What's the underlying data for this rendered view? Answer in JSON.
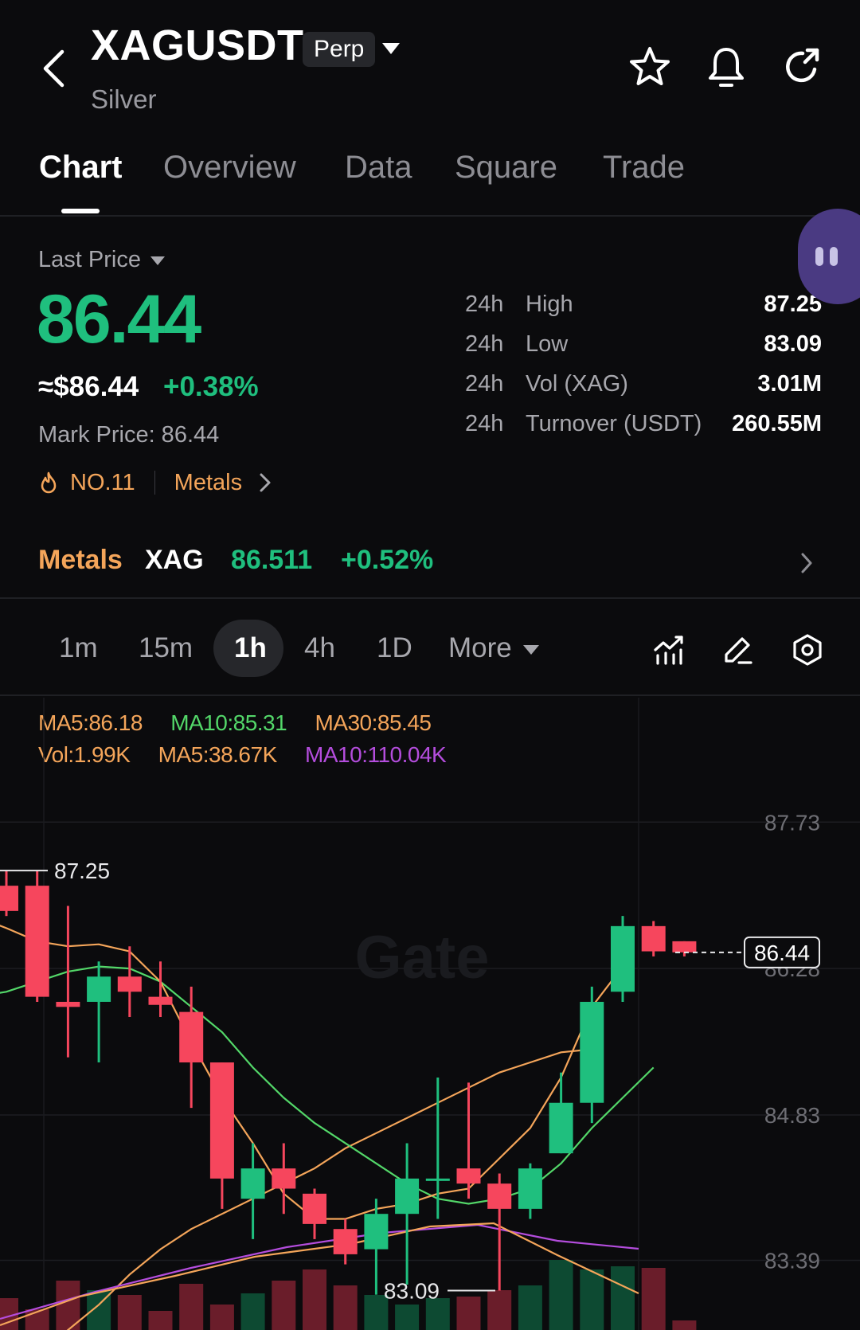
{
  "header": {
    "symbol": "XAGUSDT",
    "badge": "Perp",
    "subtitle": "Silver",
    "icons": [
      "back-icon",
      "star-icon",
      "bell-icon",
      "share-icon"
    ]
  },
  "tabs": [
    {
      "label": "Chart",
      "active": true
    },
    {
      "label": "Overview",
      "active": false
    },
    {
      "label": "Data",
      "active": false
    },
    {
      "label": "Square",
      "active": false
    },
    {
      "label": "Trade",
      "active": false
    }
  ],
  "price": {
    "label": "Last Price",
    "last": "86.44",
    "usd": "≈$86.44",
    "change": "+0.38%",
    "mark": "Mark Price: 86.44",
    "rank": "NO.11",
    "category": "Metals"
  },
  "stats": [
    {
      "period": "24h",
      "label": "High",
      "value": "87.25"
    },
    {
      "period": "24h",
      "label": "Low",
      "value": "83.09"
    },
    {
      "period": "24h",
      "label": "Vol (XAG)",
      "value": "3.01M"
    },
    {
      "period": "24h",
      "label": "Turnover (USDT)",
      "value": "260.55M"
    }
  ],
  "index": {
    "category": "Metals",
    "symbol": "XAG",
    "price": "86.511",
    "change": "+0.52%"
  },
  "intervals": [
    {
      "label": "1m",
      "active": false
    },
    {
      "label": "15m",
      "active": false
    },
    {
      "label": "1h",
      "active": true
    },
    {
      "label": "4h",
      "active": false
    },
    {
      "label": "1D",
      "active": false
    },
    {
      "label": "More",
      "active": false
    }
  ],
  "tools": [
    "indicator-icon",
    "draw-icon",
    "settings-icon"
  ],
  "legend": {
    "ma5": "MA5:86.18",
    "ma10": "MA10:85.31",
    "ma30": "MA30:85.45",
    "vol": "Vol:1.99K",
    "vol_ma5": "MA5:38.67K",
    "vol_ma10": "MA10:110.04K"
  },
  "colors": {
    "up": "#1fbf7e",
    "down": "#f6465d",
    "ma5": "#f4a55a",
    "ma10": "#53d769",
    "ma30": "#f4a55a",
    "vol_ma10": "#b44ddd",
    "accent": "#f4a55a"
  },
  "watermark": "Gate",
  "chart_data": {
    "type": "candlestick",
    "interval": "1h",
    "y_axis_labels": [
      "87.73",
      "86.28",
      "84.83",
      "83.39"
    ],
    "ylim": [
      82.7,
      88.3
    ],
    "current_price_label": "86.44",
    "high_marker": "87.25",
    "low_marker": "83.09",
    "candles": [
      {
        "o": 87.1,
        "c": 86.85,
        "h": 87.25,
        "l": 86.8
      },
      {
        "o": 87.1,
        "c": 86.0,
        "h": 87.25,
        "l": 85.95
      },
      {
        "o": 85.95,
        "c": 85.9,
        "h": 86.9,
        "l": 85.4
      },
      {
        "o": 85.95,
        "c": 86.2,
        "h": 86.35,
        "l": 85.35
      },
      {
        "o": 86.2,
        "c": 86.05,
        "h": 86.5,
        "l": 85.8
      },
      {
        "o": 86.0,
        "c": 85.92,
        "h": 86.35,
        "l": 85.8
      },
      {
        "o": 85.85,
        "c": 85.35,
        "h": 86.1,
        "l": 84.9
      },
      {
        "o": 85.35,
        "c": 84.2,
        "h": 85.35,
        "l": 83.9
      },
      {
        "o": 84.0,
        "c": 84.3,
        "h": 84.55,
        "l": 83.6
      },
      {
        "o": 84.3,
        "c": 84.1,
        "h": 84.55,
        "l": 83.85
      },
      {
        "o": 84.05,
        "c": 83.75,
        "h": 84.1,
        "l": 83.6
      },
      {
        "o": 83.7,
        "c": 83.45,
        "h": 83.8,
        "l": 83.35
      },
      {
        "o": 83.5,
        "c": 83.85,
        "h": 84.0,
        "l": 83.05
      },
      {
        "o": 83.85,
        "c": 84.2,
        "h": 84.55,
        "l": 83.15
      },
      {
        "o": 84.2,
        "c": 84.2,
        "h": 85.2,
        "l": 83.8
      },
      {
        "o": 84.3,
        "c": 84.15,
        "h": 85.15,
        "l": 84.0
      },
      {
        "o": 84.15,
        "c": 83.9,
        "h": 84.25,
        "l": 83.09
      },
      {
        "o": 83.9,
        "c": 84.3,
        "h": 84.35,
        "l": 83.8
      },
      {
        "o": 84.45,
        "c": 84.95,
        "h": 85.25,
        "l": 84.45
      },
      {
        "o": 84.95,
        "c": 85.95,
        "h": 86.1,
        "l": 84.75
      },
      {
        "o": 86.05,
        "c": 86.7,
        "h": 86.8,
        "l": 85.95
      },
      {
        "o": 86.7,
        "c": 86.45,
        "h": 86.75,
        "l": 86.4
      },
      {
        "o": 86.55,
        "c": 86.44,
        "h": 86.55,
        "l": 86.4
      }
    ],
    "ma5": [
      86.8,
      86.68,
      86.55,
      86.5,
      86.52,
      86.45,
      86.15,
      85.55,
      85.0,
      84.55,
      84.05,
      83.8,
      83.8,
      83.9,
      83.95,
      84.05,
      84.1,
      84.4,
      84.7,
      85.2,
      85.9,
      86.3
    ],
    "ma10": [
      86.0,
      86.05,
      86.15,
      86.25,
      86.3,
      86.28,
      86.15,
      85.9,
      85.65,
      85.3,
      85.0,
      84.75,
      84.55,
      84.35,
      84.15,
      84.0,
      83.95,
      84.0,
      84.1,
      84.35,
      84.7,
      85.0,
      85.3
    ],
    "ma30": [
      82.25,
      82.45,
      82.7,
      82.95,
      83.25,
      83.5,
      83.7,
      83.85,
      84.0,
      84.15,
      84.3,
      84.5,
      84.65,
      84.8,
      84.95,
      85.1,
      85.25,
      85.35,
      85.45,
      85.48
    ]
  }
}
